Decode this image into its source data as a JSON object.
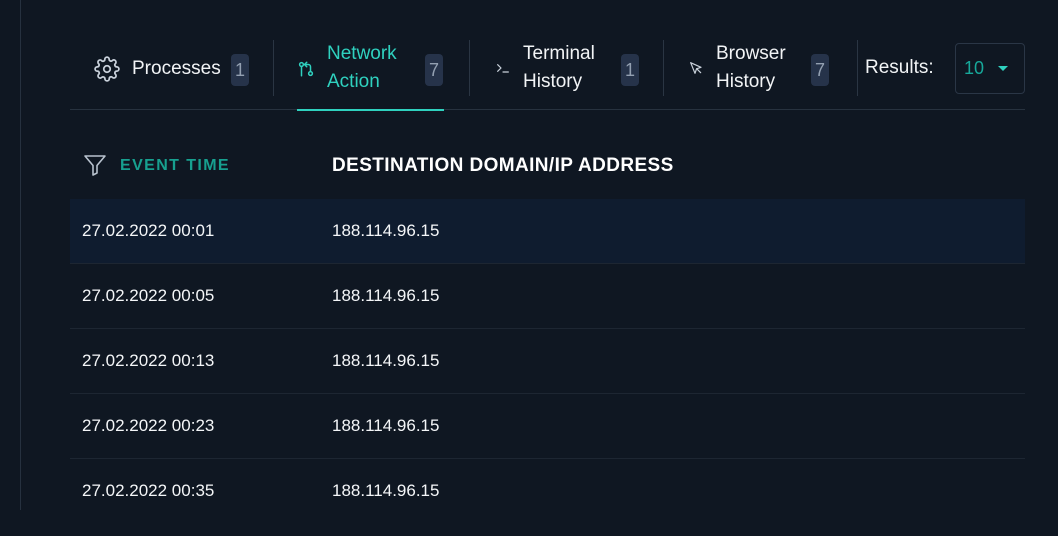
{
  "tabs": [
    {
      "label": "Processes",
      "count": "1",
      "icon": "gear-icon",
      "active": false
    },
    {
      "label_line1": "Network",
      "label_line2": "Action",
      "count": "7",
      "icon": "git-pull-icon",
      "active": true
    },
    {
      "label_line1": "Terminal",
      "label_line2": "History",
      "count": "1",
      "icon": "terminal-icon",
      "active": false
    },
    {
      "label_line1": "Browser",
      "label_line2": "History",
      "count": "7",
      "icon": "cursor-arrow-icon",
      "active": false
    }
  ],
  "results": {
    "label": "Results:",
    "value": "10"
  },
  "table": {
    "columns": [
      "EVENT TIME",
      "DESTINATION DOMAIN/IP ADDRESS"
    ],
    "rows": [
      {
        "event_time": "27.02.2022 00:01",
        "destination": "188.114.96.15"
      },
      {
        "event_time": "27.02.2022 00:05",
        "destination": "188.114.96.15"
      },
      {
        "event_time": "27.02.2022 00:13",
        "destination": "188.114.96.15"
      },
      {
        "event_time": "27.02.2022 00:23",
        "destination": "188.114.96.15"
      },
      {
        "event_time": "27.02.2022 00:35",
        "destination": "188.114.96.15"
      }
    ]
  },
  "colors": {
    "accent": "#2fd1bf",
    "background": "#0f1722",
    "badge": "#26334a"
  }
}
